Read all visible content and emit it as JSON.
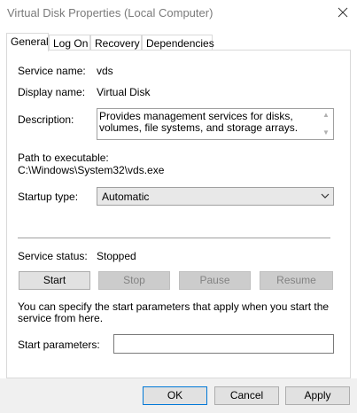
{
  "window": {
    "title": "Virtual Disk Properties (Local Computer)"
  },
  "tabs": [
    {
      "label": "General",
      "active": true
    },
    {
      "label": "Log On",
      "active": false
    },
    {
      "label": "Recovery",
      "active": false
    },
    {
      "label": "Dependencies",
      "active": false
    }
  ],
  "general": {
    "service_name_label": "Service name:",
    "service_name_value": "vds",
    "display_name_label": "Display name:",
    "display_name_value": "Virtual Disk",
    "description_label": "Description:",
    "description_value": "Provides management services for disks, volumes, file systems, and storage arrays.",
    "path_label": "Path to executable:",
    "path_value": "C:\\Windows\\System32\\vds.exe",
    "startup_type_label": "Startup type:",
    "startup_type_value": "Automatic",
    "service_status_label": "Service status:",
    "service_status_value": "Stopped",
    "buttons": {
      "start": "Start",
      "stop": "Stop",
      "pause": "Pause",
      "resume": "Resume"
    },
    "info_text": "You can specify the start parameters that apply when you start the service from here.",
    "start_params_label": "Start parameters:",
    "start_params_value": ""
  },
  "footer": {
    "ok": "OK",
    "cancel": "Cancel",
    "apply": "Apply"
  }
}
